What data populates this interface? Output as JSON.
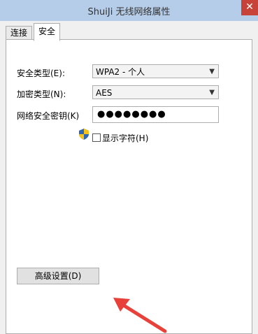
{
  "window": {
    "title": "ShuiJi 无线网络属性",
    "close_symbol": "✕"
  },
  "tabs": [
    {
      "label": "连接",
      "active": false
    },
    {
      "label": "安全",
      "active": true
    }
  ],
  "form": {
    "security_type_label": "安全类型(E):",
    "security_type_value": "WPA2 - 个人",
    "encryption_type_label": "加密类型(N):",
    "encryption_type_value": "AES",
    "key_label": "网络安全密钥(K)",
    "key_value": "●●●●●●●●",
    "show_chars_label": "显示字符(H)",
    "show_chars_checked": false
  },
  "advanced_button_label": "高级设置(D)",
  "colors": {
    "annotation_arrow": "#e8413a",
    "titlebar": "#b6cde9",
    "close_button": "#c7433a"
  },
  "icons": {
    "shield": "uac-shield-icon",
    "chevron": "chevron-down-icon"
  }
}
